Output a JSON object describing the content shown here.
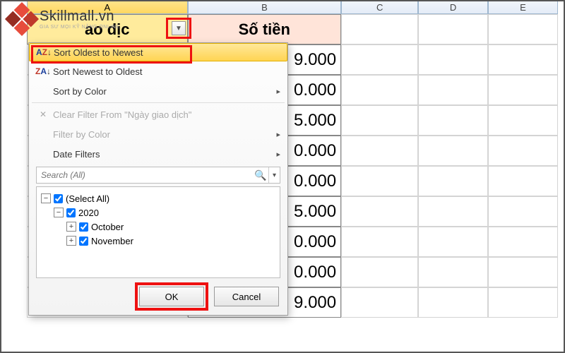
{
  "watermark": {
    "brand": "Skillmall.vn",
    "tagline": "GIA SƯ MỌI KỸ NĂNG ONLINE"
  },
  "columns": {
    "a": "A",
    "b": "B",
    "c": "C",
    "d": "D",
    "e": "E"
  },
  "header": {
    "col_a_label": "ao dịc",
    "col_b_label": "Số tiền"
  },
  "filter_button": {
    "glyph": "▼"
  },
  "rows": {
    "b": [
      "9.000",
      "0.000",
      "5.000",
      "0.000",
      "0.000",
      "5.000",
      "0.000",
      "0.000",
      "9.000"
    ]
  },
  "popup": {
    "sort_asc": "Sort Oldest to Newest",
    "sort_desc": "Sort Newest to Oldest",
    "sort_color": "Sort by Color",
    "clear_filter": "Clear Filter From \"Ngày giao dịch\"",
    "filter_color": "Filter by Color",
    "date_filters": "Date Filters",
    "search_placeholder": "Search (All)",
    "tree": {
      "select_all": "(Select All)",
      "year": "2020",
      "m1": "October",
      "m2": "November"
    },
    "ok": "OK",
    "cancel": "Cancel"
  },
  "icons": {
    "az_a": "A",
    "az_z": "Z",
    "az_arrow": "↓",
    "za_z": "Z",
    "za_a": "A",
    "submenu_arrow": "▸",
    "search_glyph": "🔍",
    "dropdown_glyph": "▾",
    "tree_minus": "−",
    "tree_plus": "+",
    "clear_funnel": "✕"
  }
}
